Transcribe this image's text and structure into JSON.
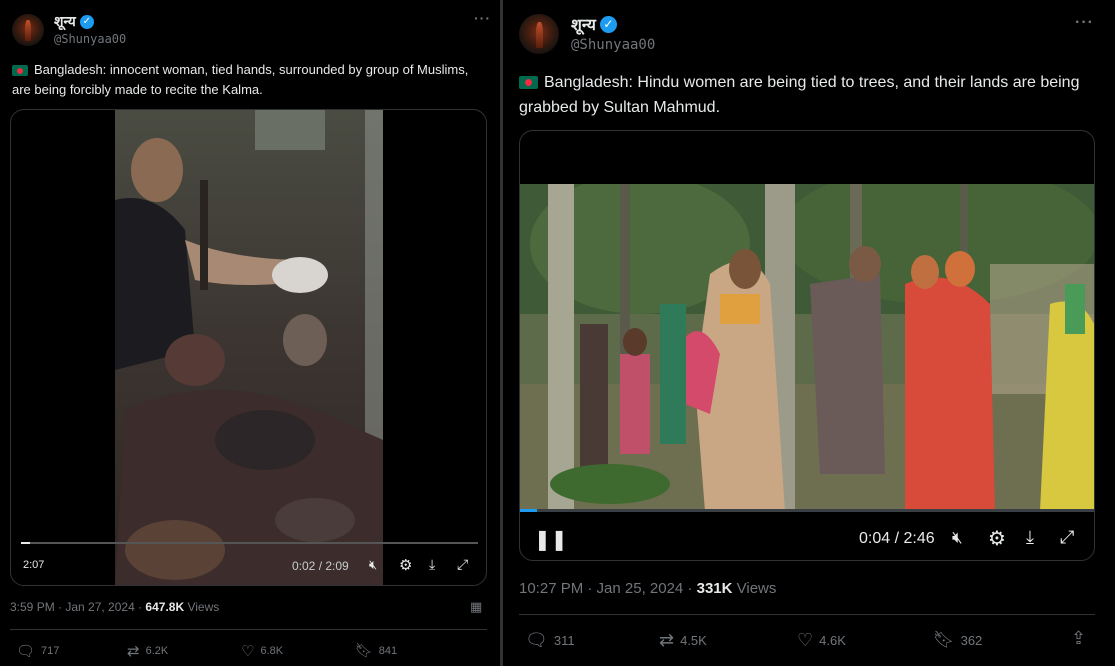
{
  "tweet_left": {
    "display_name": "शून्य",
    "handle": "@Shunyaa00",
    "text": "Bangladesh: innocent woman, tied hands, surrounded by group of Muslims, are being forcibly made to recite the Kalma.",
    "video": {
      "time": "0:02 / 2:09",
      "badge": "2:07",
      "progress": 0.02
    },
    "timestamp": "3:59 PM · Jan 27, 2024 · ",
    "views_count": "647.8K",
    "views_label": " Views",
    "stats": {
      "replies": "717",
      "reposts": "6.2K",
      "likes": "6.8K",
      "bookmarks": "841"
    }
  },
  "tweet_right": {
    "display_name": "शून्य",
    "handle": "@Shunyaa00",
    "text": "Bangladesh: Hindu women are being tied to trees, and their lands are being grabbed by Sultan Mahmud.",
    "video": {
      "time": "0:04 / 2:46",
      "progress": 0.03
    },
    "timestamp": "10:27 PM · Jan 25, 2024 · ",
    "views_count": "331K",
    "views_label": " Views",
    "stats": {
      "replies": "311",
      "reposts": "4.5K",
      "likes": "4.6K",
      "bookmarks": "362"
    }
  },
  "colors": {
    "verified": "#1d9bf0",
    "muted": "#71767b",
    "flag_green": "#006a4e",
    "flag_red": "#f42a41"
  }
}
